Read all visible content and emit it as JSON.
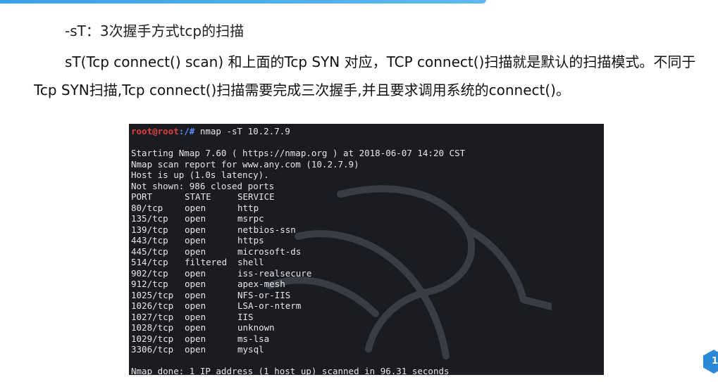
{
  "heading": "-sT：3次握手方式tcp的扫描",
  "paragraph": "sT(Tcp connect() scan) 和上面的Tcp SYN 对应，TCP connect()扫描就是默认的扫描模式。不同于Tcp SYN扫描,Tcp connect()扫描需要完成三次握手,并且要求调用系统的connect()。",
  "terminal": {
    "prompt_user": "root@root",
    "prompt_path": ":/#",
    "command": " nmap -sT 10.2.7.9",
    "start_line": "Starting Nmap 7.60 ( https://nmap.org ) at 2018-06-07 14:20 CST",
    "report_line": "Nmap scan report for www.any.com (10.2.7.9)",
    "host_line": "Host is up (1.0s latency).",
    "not_shown_line": "Not shown: 986 closed ports",
    "columns": [
      "PORT",
      "STATE",
      "SERVICE"
    ],
    "ports": [
      {
        "port": "80/tcp",
        "state": "open",
        "service": "http"
      },
      {
        "port": "135/tcp",
        "state": "open",
        "service": "msrpc"
      },
      {
        "port": "139/tcp",
        "state": "open",
        "service": "netbios-ssn"
      },
      {
        "port": "443/tcp",
        "state": "open",
        "service": "https"
      },
      {
        "port": "445/tcp",
        "state": "open",
        "service": "microsoft-ds"
      },
      {
        "port": "514/tcp",
        "state": "filtered",
        "service": "shell"
      },
      {
        "port": "902/tcp",
        "state": "open",
        "service": "iss-realsecure"
      },
      {
        "port": "912/tcp",
        "state": "open",
        "service": "apex-mesh"
      },
      {
        "port": "1025/tcp",
        "state": "open",
        "service": "NFS-or-IIS"
      },
      {
        "port": "1026/tcp",
        "state": "open",
        "service": "LSA-or-nterm"
      },
      {
        "port": "1027/tcp",
        "state": "open",
        "service": "IIS"
      },
      {
        "port": "1028/tcp",
        "state": "open",
        "service": "unknown"
      },
      {
        "port": "1029/tcp",
        "state": "open",
        "service": "ms-lsa"
      },
      {
        "port": "3306/tcp",
        "state": "open",
        "service": "mysql"
      }
    ],
    "done_line": "Nmap done: 1 IP address (1 host up) scanned in 96.31 seconds"
  },
  "badge_text": "1",
  "colors": {
    "accent": "#3aa0e8",
    "terminal_bg": "#1a1c22",
    "prompt_user": "#e04040",
    "prompt_path": "#5a8cff"
  }
}
